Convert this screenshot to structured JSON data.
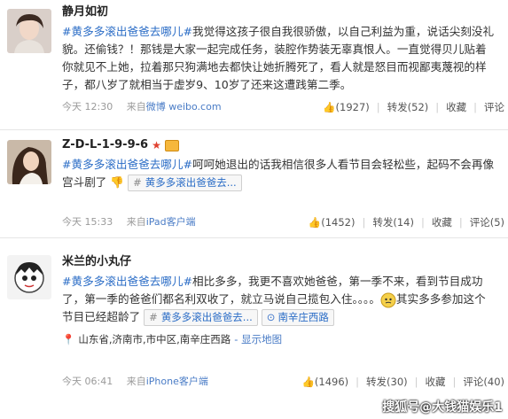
{
  "posts": [
    {
      "username": "静月如初",
      "tag": "#黄多多滚出爸爸去哪儿#",
      "body": "我觉得这孩子很自我很骄傲，以自己利益为重，说话尖刻没礼貌。还偷钱？！那钱是大家一起完成任务，装腔作势装无辜真恨人。一直觉得贝儿贴着你就见不上她，拉着那只狗满地去都快让她折腾死了，看人就是怒目而视鄙夷蔑视的样子，都八岁了就相当于虚岁9、10岁了还来这遭践第二季。",
      "time": "今天 12:30",
      "source_prefix": "来自",
      "source": "微博 weibo.com",
      "likes": "(1927)",
      "repost": "转发(52)",
      "favorite": "收藏",
      "comment": "评论"
    },
    {
      "username": "Z-D-L-1-9-9-6",
      "tag": "#黄多多滚出爸爸去哪儿#",
      "body": "呵呵她退出的话我相信很多人看节目会轻松些，起码不会再像宫斗剧了",
      "topic_chip": "黄多多滚出爸爸去...",
      "time": "今天 15:33",
      "source_prefix": "来自",
      "source": "iPad客户端",
      "likes": "(1452)",
      "repost": "转发(14)",
      "favorite": "收藏",
      "comment": "评论(5)"
    },
    {
      "username": "米兰的小丸仔",
      "tag": "#黄多多滚出爸爸去哪儿#",
      "body": "相比多多，我更不喜欢她爸爸，第一季不来，看到节目成功了，第一季的爸爸们都名利双收了，就立马说自己揽包入住。。。。",
      "body_tail": "其实多多参加这个节目已经超龄了",
      "topic_chip": "黄多多滚出爸爸去...",
      "location_chip": "南辛庄西路",
      "geo": "山东省,济南市,市中区,南辛庄西路",
      "geo_link": "- 显示地图",
      "time": "今天 06:41",
      "source_prefix": "来自",
      "source": "iPhone客户端",
      "likes": "(1496)",
      "repost": "转发(30)",
      "favorite": "收藏",
      "comment": "评论(40)"
    }
  ],
  "watermark": "搜狐号@大钱猫娱乐1",
  "colors": {
    "link": "#2a6cc6",
    "meta": "#9a9a9a",
    "divider": "#e6e6e6"
  },
  "icons": [
    "thumb-up-icon",
    "hash-icon",
    "location-pin-icon",
    "star-icon",
    "vip-icon",
    "emoji-icon"
  ]
}
